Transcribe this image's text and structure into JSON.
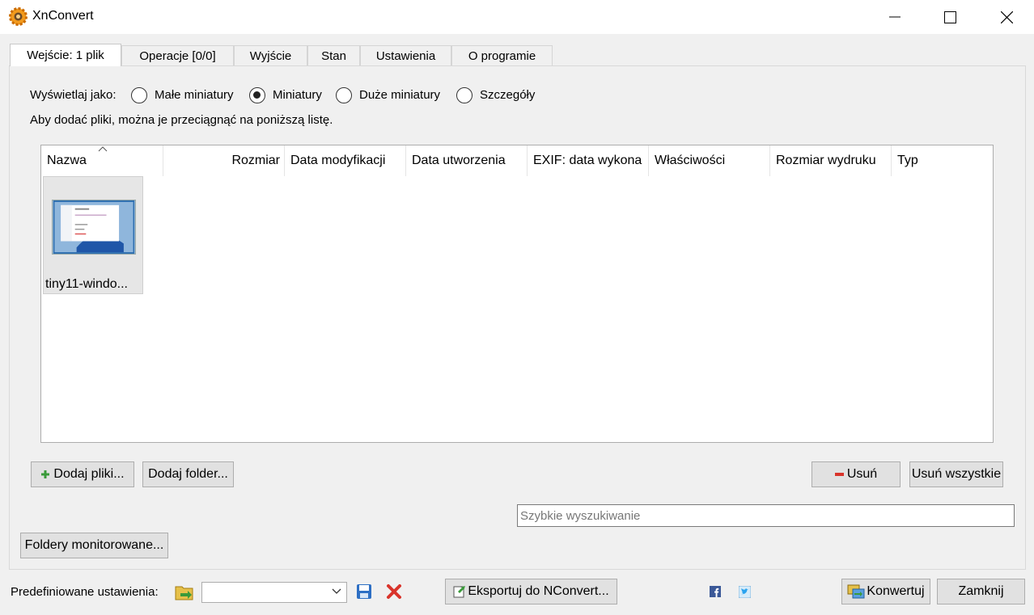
{
  "window": {
    "title": "XnConvert",
    "minimize_icon": "minimize-icon",
    "maximize_icon": "maximize-icon",
    "close_icon": "close-icon"
  },
  "tabs": [
    {
      "label": "Wejście: 1 plik",
      "active": true
    },
    {
      "label": "Operacje [0/0]",
      "active": false
    },
    {
      "label": "Wyjście",
      "active": false
    },
    {
      "label": "Stan",
      "active": false
    },
    {
      "label": "Ustawienia",
      "active": false
    },
    {
      "label": "O programie",
      "active": false
    }
  ],
  "view_options": {
    "label": "Wyświetlaj jako:",
    "options": [
      {
        "label": "Małe miniatury",
        "selected": false
      },
      {
        "label": "Miniatury",
        "selected": true
      },
      {
        "label": "Duże miniatury",
        "selected": false
      },
      {
        "label": "Szczegóły",
        "selected": false
      }
    ]
  },
  "hint": "Aby dodać pliki, można je przeciągnąć na poniższą listę.",
  "columns": [
    "Nazwa",
    "Rozmiar",
    "Data modyfikacji",
    "Data utworzenia",
    "EXIF: data wykona",
    "Właściwości",
    "Rozmiar wydruku",
    "Typ"
  ],
  "files": [
    {
      "name": "tiny11-windo..."
    }
  ],
  "buttons": {
    "add_files": "Dodaj pliki...",
    "add_folder": "Dodaj folder...",
    "remove": "Usuń",
    "remove_all": "Usuń wszystkie",
    "monitored_folders": "Foldery monitorowane...",
    "export": "Eksportuj do NConvert...",
    "convert": "Konwertuj",
    "close": "Zamknij"
  },
  "search": {
    "placeholder": "Szybkie wyszukiwanie"
  },
  "presets": {
    "label": "Predefiniowane ustawienia:",
    "value": ""
  },
  "colors": {
    "accent_blue": "#1f6fb5",
    "remove_red": "#d9342b",
    "add_green": "#3a9a3a"
  }
}
